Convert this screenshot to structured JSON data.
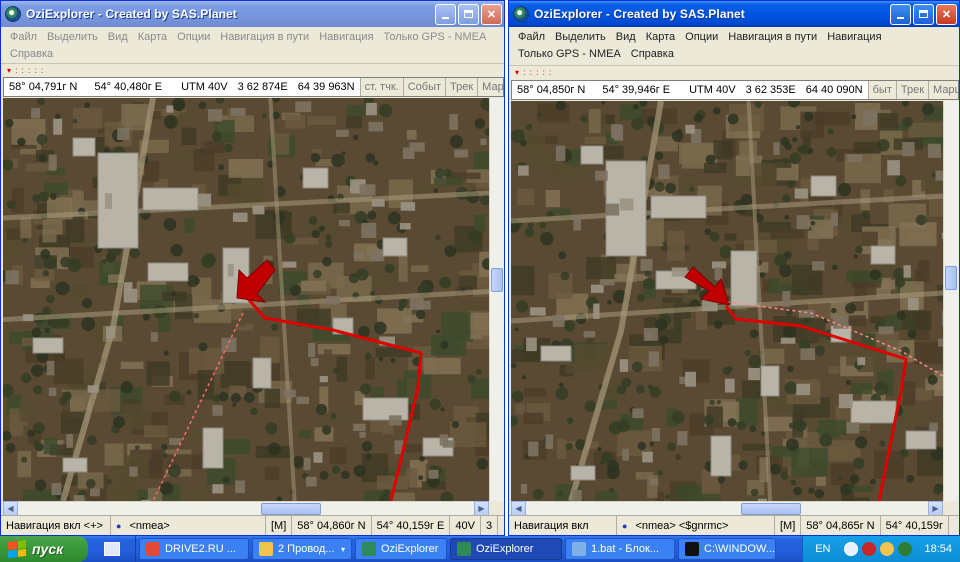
{
  "windows": [
    {
      "id": "left",
      "title": "OziExplorer - Created by SAS.Planet",
      "active": false,
      "menu": [
        "Файл",
        "Выделить",
        "Вид",
        "Карта",
        "Опции",
        "Навигация в пути",
        "Навигация",
        "Только GPS - NMEA",
        "Справка"
      ],
      "coords": {
        "lat": "58° 04,791г N",
        "lon": "54° 40,480г E",
        "utm": "UTM  40V",
        "east": "3 62 874E",
        "north": "64 39 963N"
      },
      "tabs": [
        "ст. тчк.",
        "Событ",
        "Трек",
        "Марш"
      ],
      "status": {
        "nav": "Навигация вкл  <+>",
        "mode": "<nmea>",
        "datum": "[M]",
        "lat": "58° 04,860г N",
        "lon": "54° 40,159г E",
        "zone": "40V",
        "extra": "3"
      }
    },
    {
      "id": "right",
      "title": "OziExplorer - Created by SAS.Planet",
      "active": true,
      "menu": [
        "Файл",
        "Выделить",
        "Вид",
        "Карта",
        "Опции",
        "Навигация в пути",
        "Навигация",
        "Только GPS - NMEA",
        "Справка"
      ],
      "coords": {
        "lat": "58° 04,850г N",
        "lon": "54° 39,946г E",
        "utm": "UTM  40V",
        "east": "3 62 353E",
        "north": "64 40 090N"
      },
      "tabs": [
        "быт",
        "Трек",
        "Марш"
      ],
      "status": {
        "nav": "Навигация вкл",
        "mode": "<nmea> <$gnrmc>",
        "datum": "[M]",
        "lat": "58° 04,865г N",
        "lon": "54° 40,159г"
      }
    }
  ],
  "taskbar": {
    "start_label": "пуск",
    "tasks": [
      {
        "label": "DRIVE2.RU ...",
        "icon": "chrome-icon",
        "color": "#e0483a",
        "active": false
      },
      {
        "label": "2 Провод...",
        "icon": "folder-icon",
        "color": "#f2c44e",
        "active": false,
        "group": true
      },
      {
        "label": "OziExplorer",
        "icon": "ozi-icon",
        "color": "#2e8b57",
        "active": false
      },
      {
        "label": "OziExplorer",
        "icon": "ozi-icon",
        "color": "#2e8b57",
        "active": true
      },
      {
        "label": "1.bat - Блок...",
        "icon": "notepad-icon",
        "color": "#7fb0e6",
        "active": false
      },
      {
        "label": "C:\\WINDOW...",
        "icon": "cmd-icon",
        "color": "#111111",
        "active": false
      }
    ],
    "lang": "EN",
    "clock": "18:54"
  },
  "colors": {
    "track": "#e00000",
    "arrow": "#c00000",
    "titlebar_active": "#0054e3",
    "titlebar_inactive": "#7a96dc",
    "taskbar": "#245edb",
    "start": "#3b9a3b"
  }
}
